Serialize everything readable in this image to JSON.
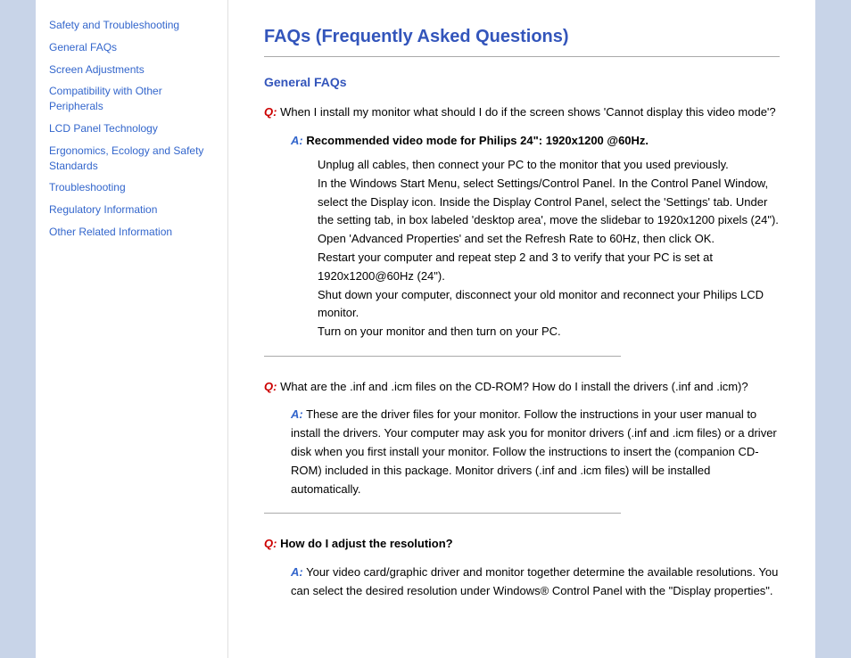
{
  "sidebar": {
    "title": "Safety and Troubleshooting",
    "links": [
      {
        "id": "safety-troubleshooting",
        "label": "Safety and Troubleshooting"
      },
      {
        "id": "general-faqs",
        "label": "General FAQs"
      },
      {
        "id": "screen-adjustments",
        "label": "Screen Adjustments"
      },
      {
        "id": "compatibility",
        "label": "Compatibility with Other Peripherals"
      },
      {
        "id": "lcd-panel",
        "label": "LCD Panel Technology"
      },
      {
        "id": "ergonomics",
        "label": "Ergonomics, Ecology and Safety Standards"
      },
      {
        "id": "troubleshooting",
        "label": "Troubleshooting"
      },
      {
        "id": "regulatory",
        "label": "Regulatory Information"
      },
      {
        "id": "other-related",
        "label": "Other Related Information"
      }
    ]
  },
  "main": {
    "page_title": "FAQs (Frequently Asked Questions)",
    "section_heading": "General FAQs",
    "questions": [
      {
        "id": "q1",
        "q_label": "Q:",
        "question": " When I install my monitor what should I do if the screen shows 'Cannot display this video mode'?",
        "a_label": "A:",
        "answer_main": " Recommended video mode for Philips 24\": 1920x1200 @60Hz.",
        "answer_detail": "Unplug all cables, then connect your PC to the monitor that you used previously.\nIn the Windows Start Menu, select Settings/Control Panel. In the Control Panel Window, select the Display icon. Inside the Display Control Panel, select the 'Settings' tab. Under the setting tab, in box labeled 'desktop area', move the slidebar to 1920x1200 pixels (24\").\nOpen 'Advanced Properties' and set the Refresh Rate to 60Hz, then click OK.\nRestart your computer and repeat step 2 and 3 to verify that your PC is set at 1920x1200@60Hz (24\").\nShut down your computer, disconnect your old monitor and reconnect your Philips LCD monitor.\nTurn on your monitor and then turn on your PC."
      },
      {
        "id": "q2",
        "q_label": "Q:",
        "question": " What are the .inf and .icm files on the CD-ROM? How do I install the drivers (.inf and .icm)?",
        "a_label": "A:",
        "answer_main": "",
        "answer_text": "These are the driver files for your monitor. Follow the instructions in your user manual to install the drivers. Your computer may ask you for monitor drivers (.inf and .icm files) or a driver disk when you first install your monitor. Follow the instructions to insert the (companion CD-ROM) included in this package. Monitor drivers (.inf and .icm files) will be installed automatically."
      },
      {
        "id": "q3",
        "q_label": "Q:",
        "question": " How do I adjust the resolution?",
        "a_label": "A:",
        "answer_text": "Your video card/graphic driver and monitor together determine the available resolutions. You can select the desired resolution under Windows® Control Panel with the \"Display properties\"."
      }
    ]
  }
}
